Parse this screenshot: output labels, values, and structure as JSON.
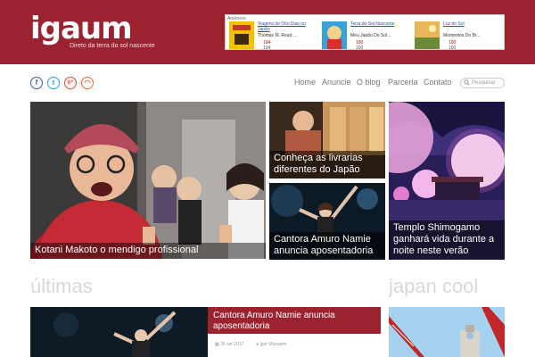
{
  "header": {
    "logo": "igaum",
    "tagline": "Direto da terra do sol nascente",
    "bg_color": "#9b2330"
  },
  "ads": {
    "label": "Anúncios",
    "items": [
      {
        "title": "Viagens de Oito Dias no Japão",
        "author": "Thomas M. Read ...",
        "price": "194",
        "price2": "194"
      },
      {
        "title": "Terra do Sol Nascente",
        "author": "Meu Japão Do Sol...",
        "price": "100",
        "price2": "100"
      },
      {
        "title": "Luz do Sol",
        "author": "Momentos Do Br...",
        "price": "100",
        "price2": "100"
      }
    ]
  },
  "social": [
    {
      "icon": "facebook-icon",
      "glyph": "f",
      "color": "#3b5998"
    },
    {
      "icon": "twitter-icon",
      "glyph": "t",
      "color": "#1da1f2"
    },
    {
      "icon": "google-plus-icon",
      "glyph": "g+",
      "color": "#dd4b39"
    },
    {
      "icon": "rss-icon",
      "glyph": "◠",
      "color": "#f26522"
    }
  ],
  "nav": {
    "items": [
      "Home",
      "Anuncie",
      "O blog",
      "Parceria",
      "Contato"
    ],
    "search_placeholder": "Pesquisar"
  },
  "featured": [
    {
      "caption": "Kotani Makoto o mendigo profissional"
    },
    {
      "caption": "Conheça as livrarias diferentes do Japão"
    },
    {
      "caption": "Cantora Amuro Namie anuncia aposentadoria"
    },
    {
      "caption": "Templo Shimogamo ganhará vida durante a noite neste verão"
    }
  ],
  "sections": {
    "latest": "últimas",
    "japan_cool": "japan cool"
  },
  "latest_post": {
    "title": "Cantora Amuro Namie anuncia aposentadoria",
    "date": "26 set 2017",
    "author": "Igor Massami"
  }
}
